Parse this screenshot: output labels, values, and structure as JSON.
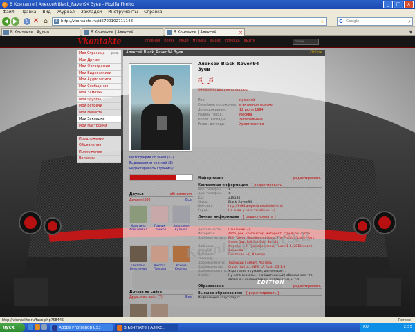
{
  "window": {
    "title": "В Контакте | Алексей Black_Raven94 Зуев - Mozilla Firefox"
  },
  "menu": [
    "Файл",
    "Правка",
    "Вид",
    "Журнал",
    "Закладки",
    "Инструменты",
    "Справка"
  ],
  "browser": {
    "url": "http://vkontakte.ru/id5790102711148",
    "search_placeholder": "Google",
    "tabs": [
      {
        "label": "В Контакте | Аудио",
        "active": false
      },
      {
        "label": "В Контакте | Алексей Black_Raven94 ...",
        "active": false
      },
      {
        "label": "В Контакте | Алексей Black_Raven...",
        "active": true
      }
    ],
    "status_url": "http://vkontakte.ru/fave.php?58445",
    "status_done": "Готово"
  },
  "vk": {
    "logo": "Vkontakte",
    "nav": [
      "главная",
      "поиск",
      "люди",
      "музыка",
      "видео",
      "помощь",
      "выйти"
    ],
    "search_placeholder": "поиск",
    "left_menu": [
      {
        "label": "Моя Страница",
        "edit": "ред."
      },
      {
        "label": "Мои Друзья"
      },
      {
        "label": "Мои Фотографии"
      },
      {
        "label": "Мои Видеозаписи"
      },
      {
        "label": "Мои Аудиозаписи"
      },
      {
        "label": "Мои Сообщения"
      },
      {
        "label": "Мои Заметки"
      },
      {
        "label": "Мои Группы"
      },
      {
        "label": "Мои Встречи"
      },
      {
        "label": "Мои Новости"
      },
      {
        "label": "Мои Закладки",
        "highlight": true
      },
      {
        "label": "Мои Настройки"
      },
      {
        "label": "",
        "gap": true
      },
      {
        "label": "Предложения"
      },
      {
        "label": "Объявления"
      },
      {
        "label": "Приложения"
      },
      {
        "label": "Вопросы"
      }
    ]
  },
  "profile": {
    "header": "Алексей Black_Raven94 Зуев",
    "online": "Online",
    "name_line1": "Алексей Black_Raven94",
    "name_line2": "Зуев",
    "updated": "Обновлено два дня назад ред.",
    "fields": [
      {
        "k": "Пол:",
        "v": "мужской"
      },
      {
        "k": "Семейное положение:",
        "v": "в активном поиске"
      },
      {
        "k": "День рождения:",
        "v": "12 июля 1994"
      },
      {
        "k": "Родной город:",
        "v": "Москва"
      },
      {
        "k": "Полит. взгляды:",
        "v": "либеральные"
      },
      {
        "k": "Религ. взгляды:",
        "v": "Христианство"
      }
    ],
    "left_links": [
      "Фотографии со мной (62)",
      "Видеозаписи со мной (3)",
      "Редактировать страницу"
    ],
    "rating": 0.74,
    "friends_title": "Друзья",
    "friends_updates": "обновления",
    "friends_count": "Друзья (380)",
    "friends_all": "Все",
    "friends": [
      {
        "name": "Кристина Алексеевна",
        "color": "#8a9a7a"
      },
      {
        "name": "Павлик Стонков",
        "color": "#c8a8a8"
      },
      {
        "name": "Анастасия Кулкова",
        "color": "#a0a0a8"
      },
      {
        "name": "Светлана Бельмеева",
        "color": "#6a5a4a"
      },
      {
        "name": "Анютка Попкова",
        "color": "#c89a88"
      },
      {
        "name": "Ксюша Кертова",
        "color": "#b07040"
      }
    ],
    "online_title": "Друзья на сайте",
    "online_count": "Друзья он-лайн (7)",
    "online_all": "Все",
    "info_section": "Информация",
    "info_edit": "редактировать",
    "contact_section": "Контактная информация",
    "contact_edit": "[ редактировать ]",
    "contacts": [
      {
        "k": "Моб. телефон:",
        "v": "#"
      },
      {
        "k": "Дом. телефон:",
        "v": "#"
      },
      {
        "k": "ICQ:",
        "v": "219184"
      },
      {
        "k": "Skype:",
        "v": "Black_Raven94"
      },
      {
        "k": "Веб-сайт:",
        "v": "http://8r94.amperia.net/index.html"
      },
      {
        "k": "Город:",
        "v": "Не знаю у кого такой ник =)"
      }
    ],
    "personal_section": "Личная информация",
    "personal_edit": "[ редактировать ]",
    "personal": [
      {
        "k": "Деятельность:",
        "v": "Школьник =)"
      },
      {
        "k": "Интересы:",
        "v": "Авто, рок, компьютер, интернет, стрельба, охота"
      },
      {
        "k": "Любимая музыка:",
        "v": "Billy Talent, Bloodhound Gang, The Prodigy, Linkin Park, Green Day, Fall Out Boy, Sum41"
      },
      {
        "k": "Любимые фильмы:",
        "v": "Форсаж 1-4, Трансформеры, Такси 1-4, 2012 много фильмов"
      },
      {
        "k": "Любимые телешоу:",
        "v": "Пинтерпе =)), Камеди"
      },
      {
        "k": "Любимые книги:",
        "v": "Турецкий Гамбит, Азазель"
      },
      {
        "k": "Любимые игры:",
        "v": "Crysis (full pc), NFS, LA Rush, CS 1.6"
      },
      {
        "k": "Любимые цитаты:",
        "v": "Утро такое в тумане, шепелявые..."
      },
      {
        "k": "О себе:",
        "v": "Ну чего сказать... я общительный) обожаю все что связано с компьютером, интернетом, и т.п."
      }
    ],
    "education_section": "Образование",
    "education_edit": "редактировать",
    "higher_ed": "Высшее образование:",
    "higher_ed_edit": "[ редактировать ]",
    "higher_ed_note": "Информация отсутствует"
  },
  "watermark": "Koenigsegg CCXR",
  "watermark2": "EDITION",
  "taskbar": {
    "start": "пуск",
    "items": [
      {
        "label": "Adobe Photoshop CS3",
        "active": false,
        "icon_color": "#2a3a8a"
      },
      {
        "label": "В Контакте | Алекс...",
        "active": true,
        "icon_color": "#e07020"
      }
    ],
    "lang": "RU",
    "time": "2:55"
  }
}
